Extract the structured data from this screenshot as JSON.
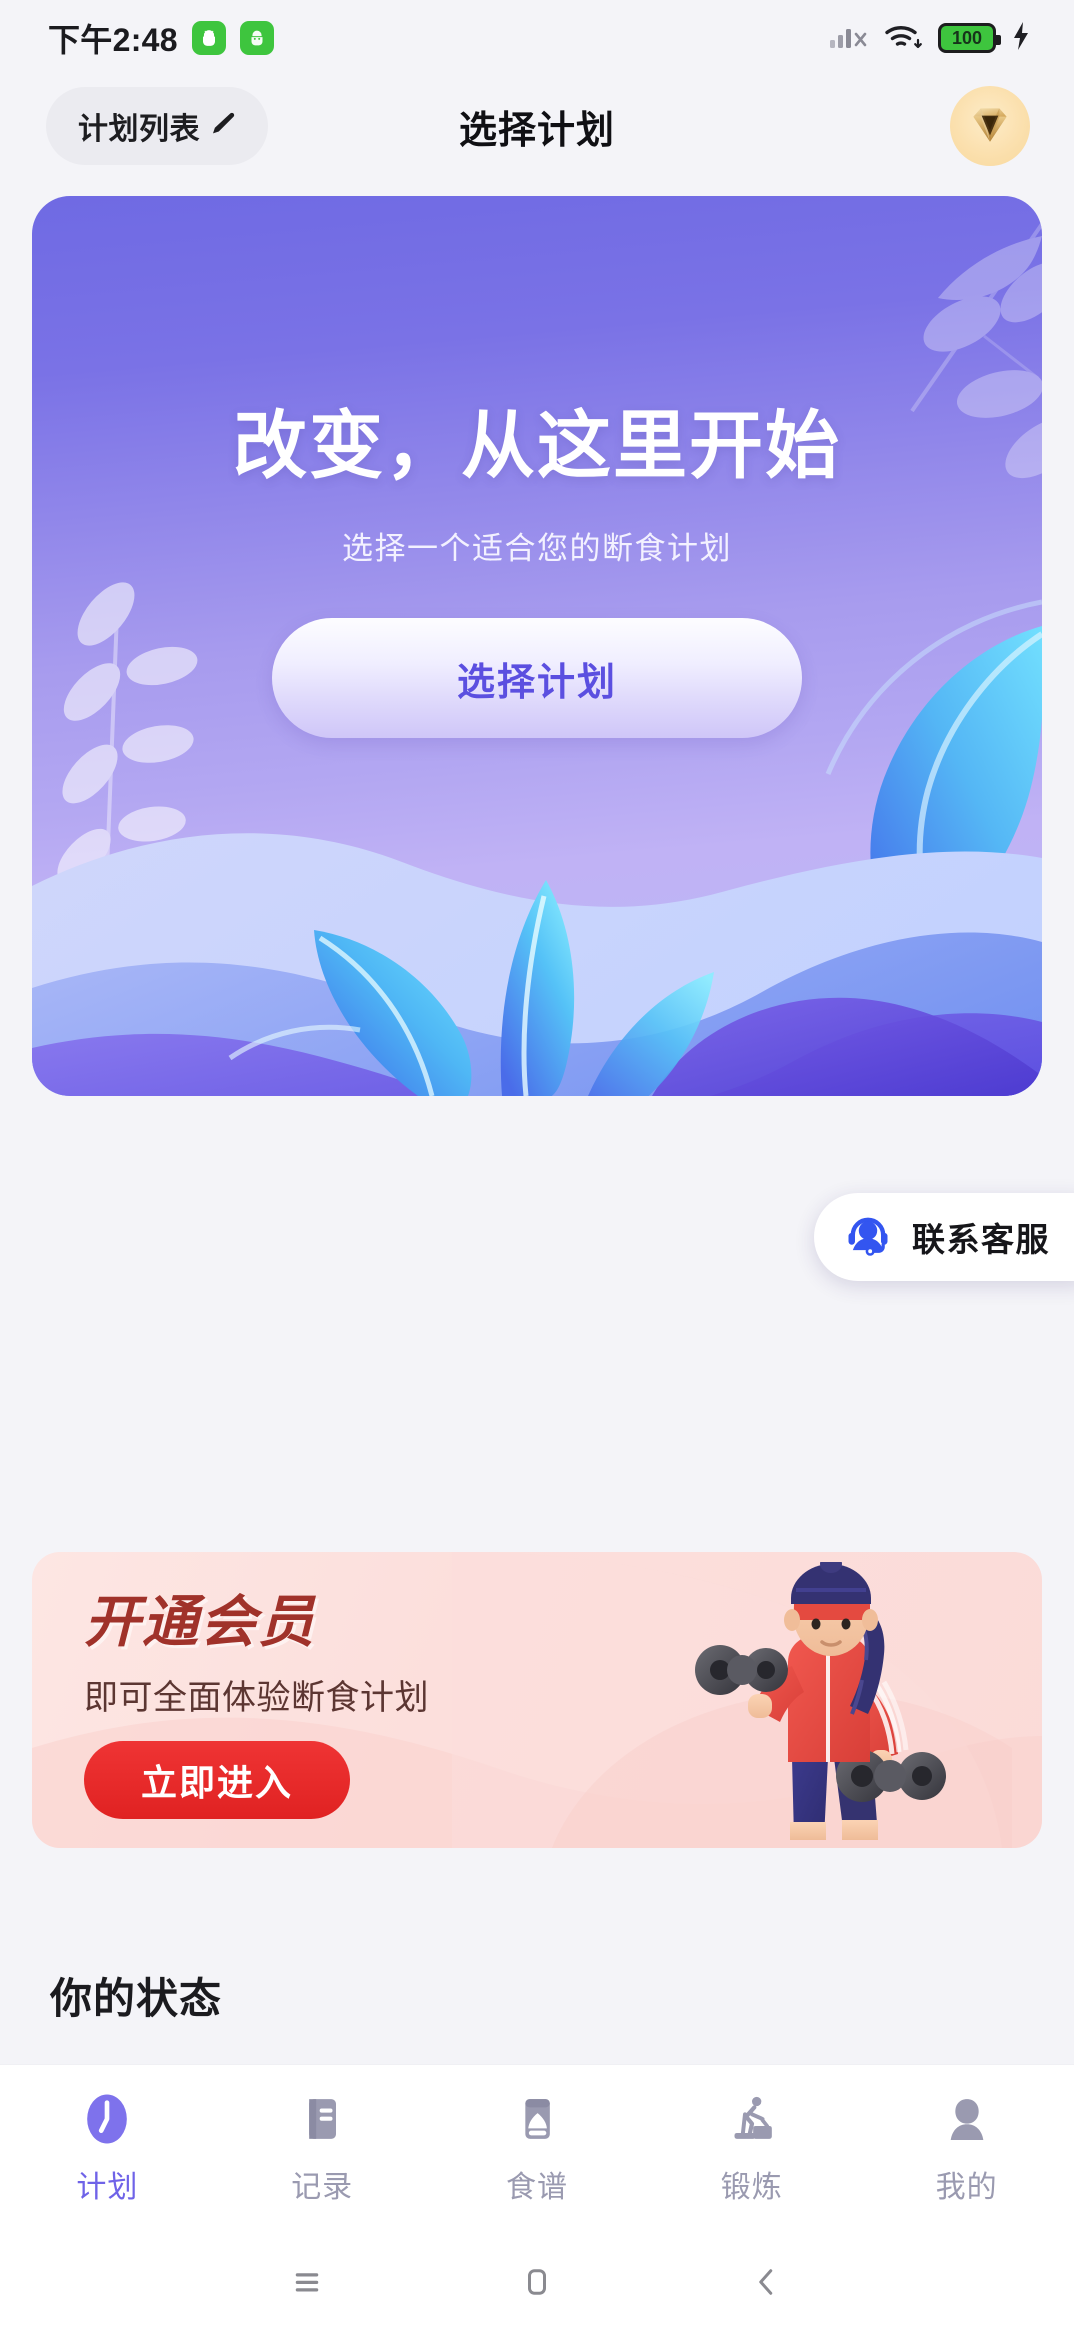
{
  "status_bar": {
    "time": "下午2:48",
    "app_badges": [
      "green-app-badge",
      "green-app-badge"
    ],
    "signal_icon": "cellular-signal-icon",
    "wifi_icon": "wifi-icon",
    "battery_level": "100",
    "charging_icon": "charging-bolt-icon"
  },
  "header": {
    "plan_list_label": "计划列表",
    "pencil_icon": "pencil-edit-icon",
    "title": "选择计划",
    "avatar_icon": "diamond-gem-icon"
  },
  "hero": {
    "title": "改变，从这里开始",
    "subtitle": "选择一个适合您的断食计划",
    "cta_label": "选择计划",
    "accent_color": "#6f6ae3",
    "cta_text_color": "#5b4fe0"
  },
  "service_fab": {
    "label": "联系客服",
    "icon": "headset-support-icon",
    "icon_color": "#3355f0"
  },
  "member_banner": {
    "title": "开通会员",
    "subtitle": "即可全面体验断食计划",
    "cta_label": "立即进入",
    "cta_color": "#e02222",
    "title_color": "#a0322a",
    "illustration": "woman-with-dumbbells-illustration"
  },
  "status_section": {
    "heading": "你的状态"
  },
  "tab_bar": {
    "active_color": "#6f63e8",
    "inactive_color": "#9a9ab0",
    "items": [
      {
        "label": "计划",
        "icon": "clock-plan-icon",
        "active": true
      },
      {
        "label": "记录",
        "icon": "book-record-icon",
        "active": false
      },
      {
        "label": "食谱",
        "icon": "food-recipe-icon",
        "active": false
      },
      {
        "label": "锻炼",
        "icon": "exercise-machine-icon",
        "active": false
      },
      {
        "label": "我的",
        "icon": "person-profile-icon",
        "active": false
      }
    ]
  },
  "nav_bar": {
    "recents_icon": "recents-menu-icon",
    "home_icon": "home-square-icon",
    "back_icon": "back-chevron-icon"
  }
}
